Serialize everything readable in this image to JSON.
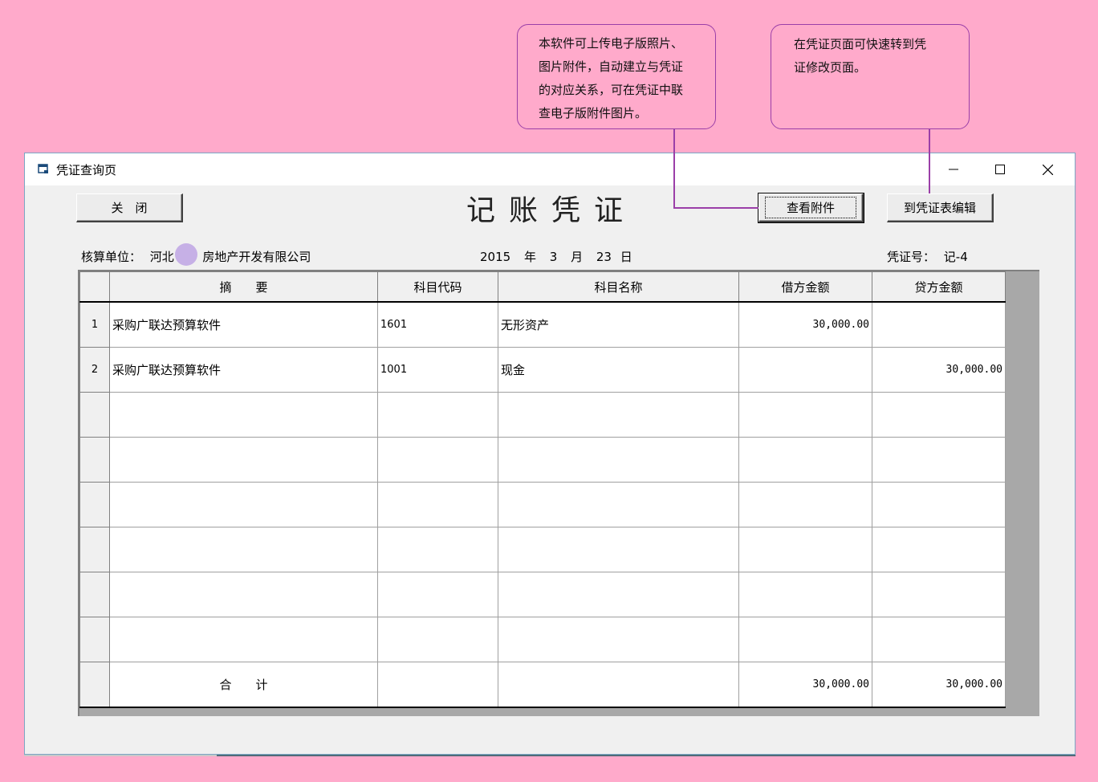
{
  "callouts": {
    "attachment_note": [
      "本软件可上传电子版照片、",
      "图片附件，自动建立与凭证",
      "的对应关系，可在凭证中联",
      "查电子版附件图片。"
    ],
    "edit_note": [
      "在凭证页面可快速转到凭",
      "证修改页面。"
    ]
  },
  "window": {
    "title": "凭证查询页",
    "minimize": "—",
    "maximize": "☐",
    "close": "✕"
  },
  "toolbar": {
    "close_label": "关　闭",
    "view_attachment_label": "查看附件",
    "edit_label": "到凭证表编辑"
  },
  "voucher": {
    "heading": "记账凭证",
    "unit_label": "核算单位：",
    "unit_name_prefix": "河北",
    "unit_name_suffix": "房地产开发有限公司",
    "year": "2015",
    "year_label": "年",
    "month": "3",
    "month_label": "月",
    "day": "23",
    "day_label": "日",
    "number_label": "凭证号：",
    "number": "记-4"
  },
  "table": {
    "headers": [
      "",
      "摘　　要",
      "科目代码",
      "科目名称",
      "借方金额",
      "贷方金额"
    ],
    "rows": [
      {
        "no": "1",
        "summary": "采购广联达预算软件",
        "code": "1601",
        "name": "无形资产",
        "debit": "30,000.00",
        "credit": ""
      },
      {
        "no": "2",
        "summary": "采购广联达预算软件",
        "code": "1001",
        "name": "现金",
        "debit": "",
        "credit": "30,000.00"
      },
      {
        "no": "",
        "summary": "",
        "code": "",
        "name": "",
        "debit": "",
        "credit": ""
      },
      {
        "no": "",
        "summary": "",
        "code": "",
        "name": "",
        "debit": "",
        "credit": ""
      },
      {
        "no": "",
        "summary": "",
        "code": "",
        "name": "",
        "debit": "",
        "credit": ""
      },
      {
        "no": "",
        "summary": "",
        "code": "",
        "name": "",
        "debit": "",
        "credit": ""
      },
      {
        "no": "",
        "summary": "",
        "code": "",
        "name": "",
        "debit": "",
        "credit": ""
      },
      {
        "no": "",
        "summary": "",
        "code": "",
        "name": "",
        "debit": "",
        "credit": ""
      }
    ],
    "total": {
      "label": "合　　计",
      "debit": "30,000.00",
      "credit": "30,000.00"
    }
  },
  "colors": {
    "background": "#ffaacb",
    "callout_border": "#9b3fa8",
    "window_bg": "#f0f0f0"
  }
}
